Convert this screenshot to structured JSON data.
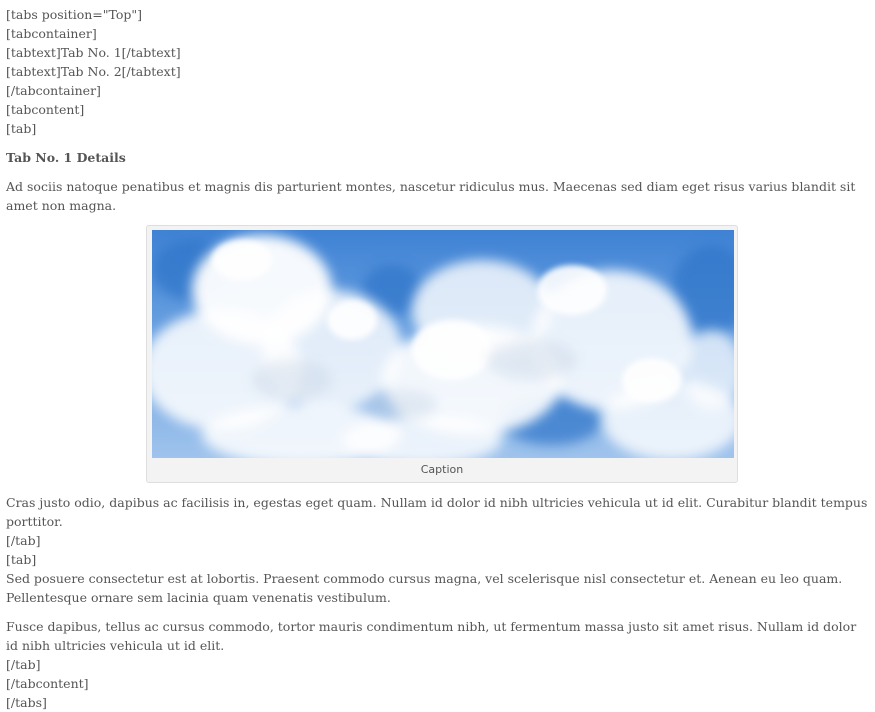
{
  "shortcodes": {
    "tabs_open": "[tabs position=\"Top\"]",
    "tabcontainer_open": "[tabcontainer]",
    "tabtext_1": "[tabtext]Tab No. 1[/tabtext]",
    "tabtext_2": "[tabtext]Tab No. 2[/tabtext]",
    "tabcontainer_close": "[/tabcontainer]",
    "tabcontent_open": "[tabcontent]",
    "tab_open_1": "[tab]",
    "tab_close_1": "[/tab]",
    "tab_open_2": "[tab]",
    "tab_close_2": "[/tab]",
    "tabcontent_close": "[/tabcontent]",
    "tabs_close": "[/tabs]"
  },
  "tab1": {
    "heading": "Tab No. 1 Details",
    "intro": "Ad sociis natoque penatibus et magnis dis parturient montes, nascetur ridiculus mus. Maecenas sed diam eget risus varius blandit sit amet non magna.",
    "figure": {
      "image": "clouds-sky-image",
      "caption": "Caption"
    },
    "after_figure": "Cras justo odio, dapibus ac facilisis in, egestas eget quam. Nullam id dolor id nibh ultricies vehicula ut id elit. Curabitur blandit tempus porttitor."
  },
  "tab2": {
    "para1": "Sed posuere consectetur est at lobortis. Praesent commodo cursus magna, vel scelerisque nisl consectetur et. Aenean eu leo quam. Pellentesque ornare sem lacinia quam venenatis vestibulum.",
    "para2": "Fusce dapibus, tellus ac cursus commodo, tortor mauris condimentum nibh, ut fermentum massa justo sit amet risus. Nullam id dolor id nibh ultricies vehicula ut id elit."
  },
  "colors": {
    "text": "#555555",
    "figure_bg": "#f3f3f3",
    "figure_border": "#dedede",
    "sky_blue": "#4a8ad6"
  }
}
